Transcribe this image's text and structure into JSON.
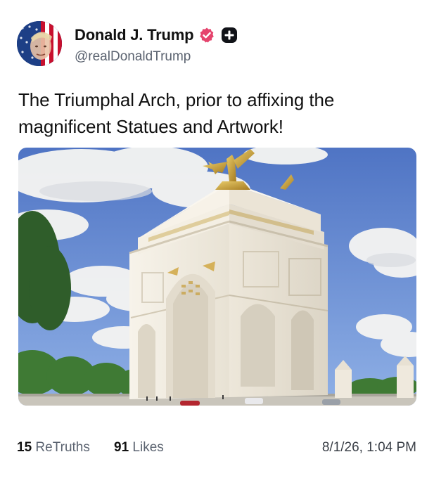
{
  "author": {
    "name": "Donald J. Trump",
    "handle": "@realDonaldTrump",
    "avatar_icon": "flag-portrait-avatar",
    "verified_icon": "verified-badge-icon",
    "verified_color": "#e5446d",
    "plus_icon": "plus-badge-icon"
  },
  "post": {
    "text": "The Triumphal Arch, prior to affixing the magnificent Statues and Artwork!",
    "media_icon": "triumphal-arch-image"
  },
  "stats": {
    "retruths_count": "15",
    "retruths_label": "ReTruths",
    "likes_count": "91",
    "likes_label": "Likes",
    "timestamp": "8/1/26, 1:04 PM"
  }
}
